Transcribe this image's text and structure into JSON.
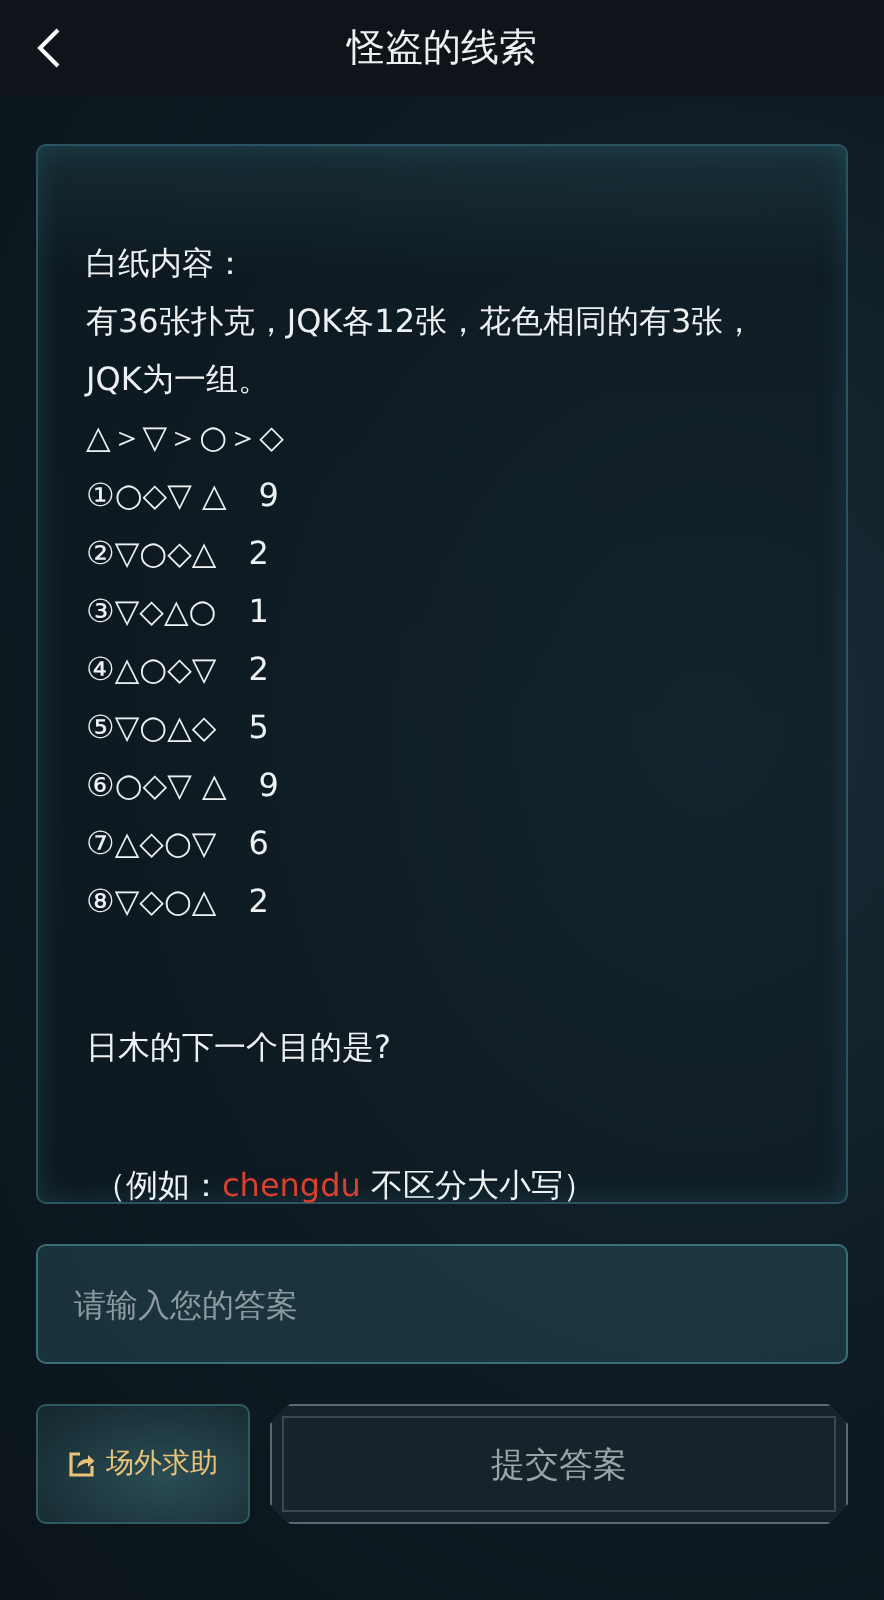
{
  "header": {
    "title": "怪盗的线索"
  },
  "clue_card": {
    "lines": [
      "白纸内容：",
      "有36张扑克，JQK各12张，花色相同的有3张，JQK为一组。",
      "△＞▽＞○＞◇",
      "①○◇▽ △　9",
      "②▽○◇△　2",
      "③▽◇△○　1",
      "④△○◇▽　2",
      "⑤▽○△◇　5",
      "⑥○◇▽ △　9",
      "⑦△◇○▽　6",
      "⑧▽◇○△　2"
    ],
    "question": "日木的下一个目的是?",
    "hint": {
      "before": "（例如：",
      "highlight": "chengdu",
      "after": " 不区分大小写）"
    }
  },
  "answer_field": {
    "placeholder": "请输入您的答案"
  },
  "help_button": {
    "label": "场外求助"
  },
  "submit_button": {
    "label": "提交答案",
    "disabled": true
  }
}
